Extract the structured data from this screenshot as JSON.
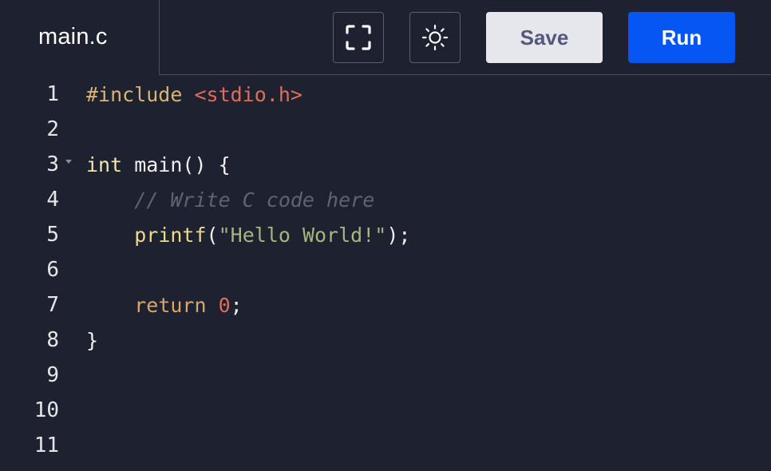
{
  "tab": {
    "label": "main.c"
  },
  "toolbar": {
    "fullscreen_icon": "fullscreen-icon",
    "theme_icon": "sun-icon",
    "save_label": "Save",
    "run_label": "Run"
  },
  "colors": {
    "background": "#1d2130",
    "run_button": "#0556f3",
    "save_button": "#e6e7ec",
    "save_text": "#54597b"
  },
  "editor": {
    "lines": [
      {
        "number": "1",
        "tokens": [
          {
            "t": "#include ",
            "c": "directive"
          },
          {
            "t": "<stdio.h>",
            "c": "header"
          }
        ]
      },
      {
        "number": "2",
        "tokens": []
      },
      {
        "number": "3",
        "tokens": [
          {
            "t": "int",
            "c": "type"
          },
          {
            "t": " main() {",
            "c": "plain"
          }
        ]
      },
      {
        "number": "4",
        "tokens": [
          {
            "t": "    ",
            "c": "plain"
          },
          {
            "t": "// Write C code here",
            "c": "comment"
          }
        ]
      },
      {
        "number": "5",
        "tokens": [
          {
            "t": "    ",
            "c": "plain"
          },
          {
            "t": "printf",
            "c": "func"
          },
          {
            "t": "(",
            "c": "plain"
          },
          {
            "t": "\"Hello World!\"",
            "c": "string"
          },
          {
            "t": ");",
            "c": "plain"
          }
        ]
      },
      {
        "number": "6",
        "tokens": []
      },
      {
        "number": "7",
        "tokens": [
          {
            "t": "    ",
            "c": "plain"
          },
          {
            "t": "return",
            "c": "keyword"
          },
          {
            "t": " ",
            "c": "plain"
          },
          {
            "t": "0",
            "c": "number"
          },
          {
            "t": ";",
            "c": "plain"
          }
        ]
      },
      {
        "number": "8",
        "tokens": [
          {
            "t": "}",
            "c": "plain"
          }
        ]
      },
      {
        "number": "9",
        "tokens": []
      },
      {
        "number": "10",
        "tokens": []
      },
      {
        "number": "11",
        "tokens": []
      }
    ],
    "fold_line": "3"
  }
}
